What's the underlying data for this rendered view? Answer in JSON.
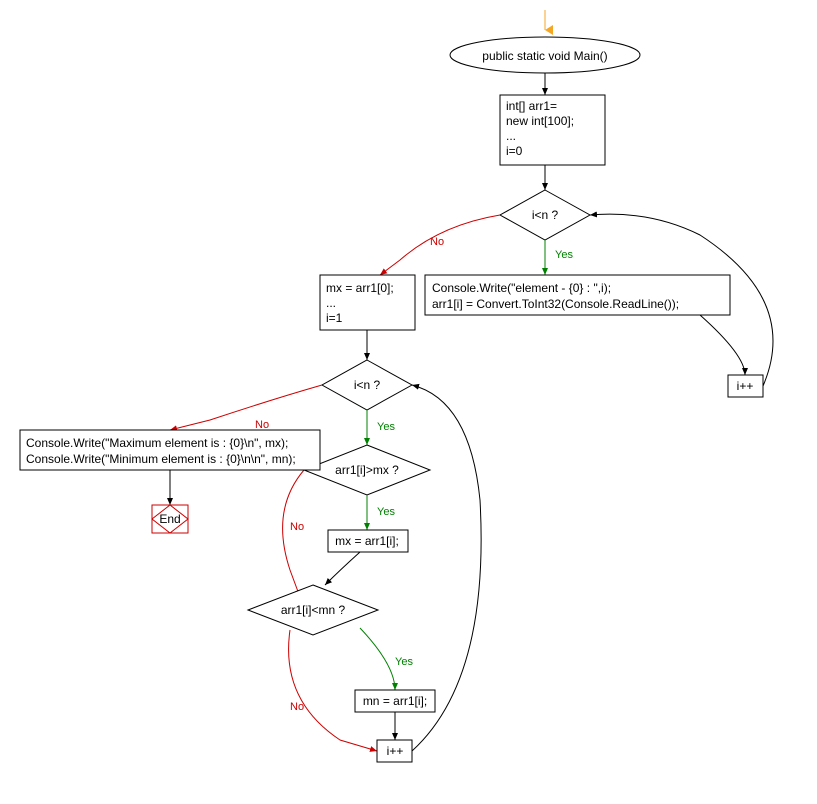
{
  "start": {
    "label": "public static void Main()"
  },
  "init_block": {
    "line1": "int[] arr1=",
    "line2": "new int[100];",
    "line3": "...",
    "line4": "i=0"
  },
  "cond1": {
    "label": "i<n ?",
    "yes": "Yes",
    "no": "No"
  },
  "read_block": {
    "line1": "Console.Write(\"element - {0} : \",i);",
    "line2": "arr1[i] = Convert.ToInt32(Console.ReadLine());"
  },
  "inc1": {
    "label": "i++"
  },
  "mxinit_block": {
    "line1": "mx = arr1[0];",
    "line2": "...",
    "line3": "i=1"
  },
  "cond2": {
    "label": "i<n ?",
    "yes": "Yes",
    "no": "No"
  },
  "cond3": {
    "label": "arr1[i]>mx ?",
    "yes": "Yes",
    "no": "No"
  },
  "setmx": {
    "label": "mx = arr1[i];"
  },
  "cond4": {
    "label": "arr1[i]<mn ?",
    "yes": "Yes",
    "no": "No"
  },
  "setmn": {
    "label": "mn = arr1[i];"
  },
  "inc2": {
    "label": "i++"
  },
  "output_block": {
    "line1": "Console.Write(\"Maximum element is : {0}\\n\", mx);",
    "line2": "Console.Write(\"Minimum element is : {0}\\n\\n\", mn);"
  },
  "end": {
    "label": "End"
  },
  "chart_data": {
    "type": "flowchart",
    "nodes": [
      {
        "id": "entry",
        "type": "arrow-start"
      },
      {
        "id": "start",
        "type": "terminator",
        "text": "public static void Main()"
      },
      {
        "id": "init",
        "type": "process",
        "text": "int[] arr1= new int[100]; ... i=0"
      },
      {
        "id": "cond1",
        "type": "decision",
        "text": "i<n ?"
      },
      {
        "id": "read",
        "type": "process",
        "text": "Console.Write(\"element - {0} : \",i); arr1[i] = Convert.ToInt32(Console.ReadLine());"
      },
      {
        "id": "inc1",
        "type": "process",
        "text": "i++"
      },
      {
        "id": "mxinit",
        "type": "process",
        "text": "mx = arr1[0]; ... i=1"
      },
      {
        "id": "cond2",
        "type": "decision",
        "text": "i<n ?"
      },
      {
        "id": "cond3",
        "type": "decision",
        "text": "arr1[i]>mx ?"
      },
      {
        "id": "setmx",
        "type": "process",
        "text": "mx = arr1[i];"
      },
      {
        "id": "cond4",
        "type": "decision",
        "text": "arr1[i]<mn ?"
      },
      {
        "id": "setmn",
        "type": "process",
        "text": "mn = arr1[i];"
      },
      {
        "id": "inc2",
        "type": "process",
        "text": "i++"
      },
      {
        "id": "output",
        "type": "process",
        "text": "Console.Write(\"Maximum element is : {0}\\n\", mx); Console.Write(\"Minimum element is : {0}\\n\\n\", mn);"
      },
      {
        "id": "end",
        "type": "terminator",
        "text": "End"
      }
    ],
    "edges": [
      {
        "from": "entry",
        "to": "start"
      },
      {
        "from": "start",
        "to": "init"
      },
      {
        "from": "init",
        "to": "cond1"
      },
      {
        "from": "cond1",
        "to": "read",
        "label": "Yes"
      },
      {
        "from": "read",
        "to": "inc1"
      },
      {
        "from": "inc1",
        "to": "cond1"
      },
      {
        "from": "cond1",
        "to": "mxinit",
        "label": "No"
      },
      {
        "from": "mxinit",
        "to": "cond2"
      },
      {
        "from": "cond2",
        "to": "cond3",
        "label": "Yes"
      },
      {
        "from": "cond3",
        "to": "setmx",
        "label": "Yes"
      },
      {
        "from": "setmx",
        "to": "cond4"
      },
      {
        "from": "cond3",
        "to": "cond4",
        "label": "No"
      },
      {
        "from": "cond4",
        "to": "setmn",
        "label": "Yes"
      },
      {
        "from": "setmn",
        "to": "inc2"
      },
      {
        "from": "cond4",
        "to": "inc2",
        "label": "No"
      },
      {
        "from": "inc2",
        "to": "cond2"
      },
      {
        "from": "cond2",
        "to": "output",
        "label": "No"
      },
      {
        "from": "output",
        "to": "end"
      }
    ]
  }
}
